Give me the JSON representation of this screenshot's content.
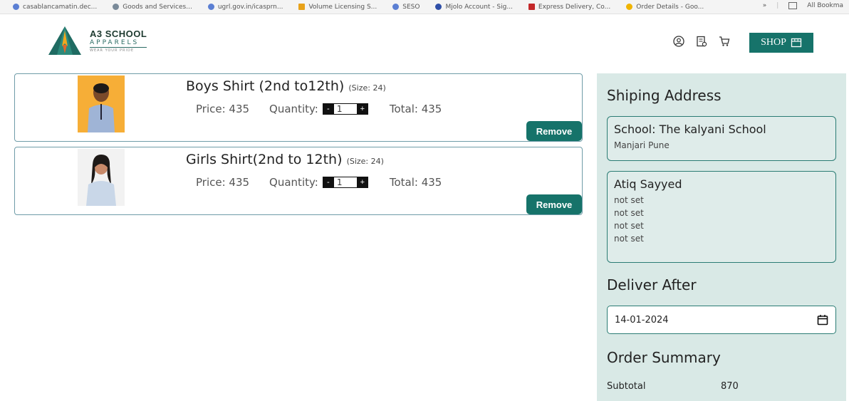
{
  "bookmarks": [
    {
      "label": "casablancamatin.dec...",
      "color": "#5b7fd3"
    },
    {
      "label": "Goods and Services...",
      "color": "#7a8a99"
    },
    {
      "label": "ugrl.gov.in/icasprn...",
      "color": "#5b7fd3"
    },
    {
      "label": "Volume Licensing S...",
      "color": "#e8a21a"
    },
    {
      "label": "SESO",
      "color": "#5b7fd3"
    },
    {
      "label": "Mjolo Account - Sig...",
      "color": "#2f4fa8"
    },
    {
      "label": "Express Delivery, Co...",
      "color": "#c4282a"
    },
    {
      "label": "Order Details - Goo...",
      "color": "#f0b400"
    }
  ],
  "bookmarks_more": "»",
  "bookmarks_all": "All Bookma",
  "logo": {
    "title": "A3 SCHOOL",
    "sub": "APPARELS",
    "tag": "WEAR YOUR PRIDE"
  },
  "header": {
    "shop_label": "SHOP"
  },
  "cart": [
    {
      "name": "Boys Shirt (2nd to12th)",
      "size": "(Size: 24)",
      "price_label": "Price: 435",
      "qty_label": "Quantity:",
      "qty_minus": "-",
      "qty": "1",
      "qty_plus": "+",
      "total_label": "Total: 435",
      "remove_label": "Remove"
    },
    {
      "name": "Girls Shirt(2nd to 12th)",
      "size": "(Size: 24)",
      "price_label": "Price: 435",
      "qty_label": "Quantity:",
      "qty_minus": "-",
      "qty": "1",
      "qty_plus": "+",
      "total_label": "Total: 435",
      "remove_label": "Remove"
    }
  ],
  "panel": {
    "shipping_title": "Shiping Address",
    "school": {
      "title": "School: The kalyani School",
      "line": "Manjari Pune"
    },
    "contact": {
      "name": "Atiq Sayyed",
      "lines": [
        "not set",
        "not set",
        "not set",
        "not set"
      ]
    },
    "deliver_title": "Deliver After",
    "deliver_date": "14-01-2024",
    "summary_title": "Order Summary",
    "subtotal_label": "Subtotal",
    "subtotal_value": "870"
  },
  "colors": {
    "accent": "#16736a",
    "panel_bg": "#d9e9e6",
    "card_border": "#6f9ca8"
  }
}
